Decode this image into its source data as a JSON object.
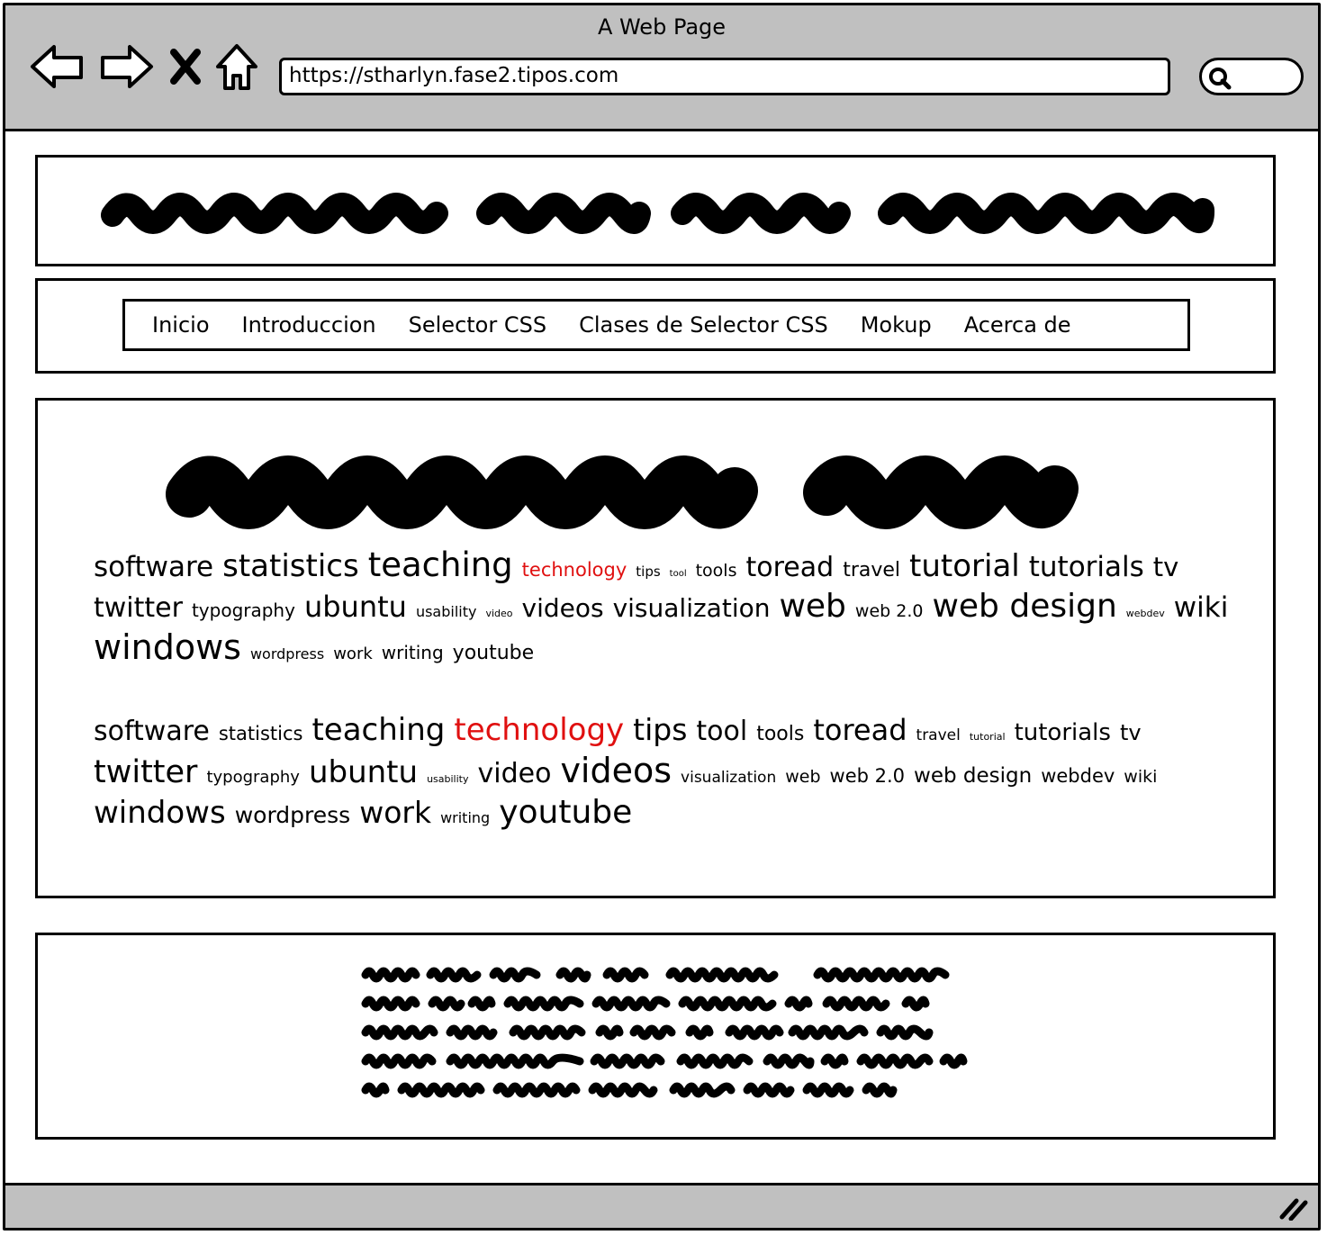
{
  "browser": {
    "title": "A Web Page",
    "url": "https://stharlyn.fase2.tipos.com",
    "icons": [
      "back-arrow-icon",
      "forward-arrow-icon",
      "close-x-icon",
      "home-icon",
      "search-icon",
      "resize-handle-icon"
    ]
  },
  "nav": {
    "items": [
      {
        "label": "Inicio"
      },
      {
        "label": "Introduccion"
      },
      {
        "label": "Selector CSS"
      },
      {
        "label": "Clases de Selector CSS"
      },
      {
        "label": "Mokup"
      },
      {
        "label": "Acerca de"
      }
    ]
  },
  "colors": {
    "highlight": "#e01010",
    "chrome": "#c0c0c0"
  },
  "tag_clouds": [
    {
      "tags": [
        {
          "text": "software",
          "size": 31
        },
        {
          "text": "statistics",
          "size": 34
        },
        {
          "text": "teaching",
          "size": 37
        },
        {
          "text": "technology",
          "size": 21,
          "highlight": true
        },
        {
          "text": "tips",
          "size": 15
        },
        {
          "text": "tool",
          "size": 10
        },
        {
          "text": "tools",
          "size": 19
        },
        {
          "text": "toread",
          "size": 30
        },
        {
          "text": "travel",
          "size": 22
        },
        {
          "text": "tutorial",
          "size": 34
        },
        {
          "text": "tutorials",
          "size": 31
        },
        {
          "text": "tv",
          "size": 29
        },
        {
          "text": "twitter",
          "size": 30
        },
        {
          "text": "typography",
          "size": 20
        },
        {
          "text": "ubuntu",
          "size": 32
        },
        {
          "text": "usability",
          "size": 16
        },
        {
          "text": "video",
          "size": 11
        },
        {
          "text": "videos",
          "size": 28
        },
        {
          "text": "visualization",
          "size": 28
        },
        {
          "text": "web",
          "size": 36
        },
        {
          "text": "web 2.0",
          "size": 19
        },
        {
          "text": "web design",
          "size": 36
        },
        {
          "text": "webdev",
          "size": 11
        },
        {
          "text": "wiki",
          "size": 31
        },
        {
          "text": "windows",
          "size": 38
        },
        {
          "text": "wordpress",
          "size": 16
        },
        {
          "text": "work",
          "size": 18
        },
        {
          "text": "writing",
          "size": 20
        },
        {
          "text": "youtube",
          "size": 22
        }
      ]
    },
    {
      "tags": [
        {
          "text": "software",
          "size": 30
        },
        {
          "text": "statistics",
          "size": 21
        },
        {
          "text": "teaching",
          "size": 34
        },
        {
          "text": "technology",
          "size": 34,
          "highlight": true
        },
        {
          "text": "tips",
          "size": 33
        },
        {
          "text": "tool",
          "size": 30
        },
        {
          "text": "tools",
          "size": 22
        },
        {
          "text": "toread",
          "size": 32
        },
        {
          "text": "travel",
          "size": 17
        },
        {
          "text": "tutorial",
          "size": 11
        },
        {
          "text": "tutorials",
          "size": 26
        },
        {
          "text": "tv",
          "size": 24
        },
        {
          "text": "twitter",
          "size": 35
        },
        {
          "text": "typography",
          "size": 18
        },
        {
          "text": "ubuntu",
          "size": 34
        },
        {
          "text": "usability",
          "size": 11
        },
        {
          "text": "video",
          "size": 30
        },
        {
          "text": "videos",
          "size": 38
        },
        {
          "text": "visualization",
          "size": 17
        },
        {
          "text": "web",
          "size": 19
        },
        {
          "text": "web 2.0",
          "size": 21
        },
        {
          "text": "web design",
          "size": 23
        },
        {
          "text": "webdev",
          "size": 21
        },
        {
          "text": "wiki",
          "size": 19
        },
        {
          "text": "windows",
          "size": 34
        },
        {
          "text": "wordpress",
          "size": 25
        },
        {
          "text": "work",
          "size": 33
        },
        {
          "text": "writing",
          "size": 16
        },
        {
          "text": "youtube",
          "size": 36
        }
      ]
    }
  ]
}
